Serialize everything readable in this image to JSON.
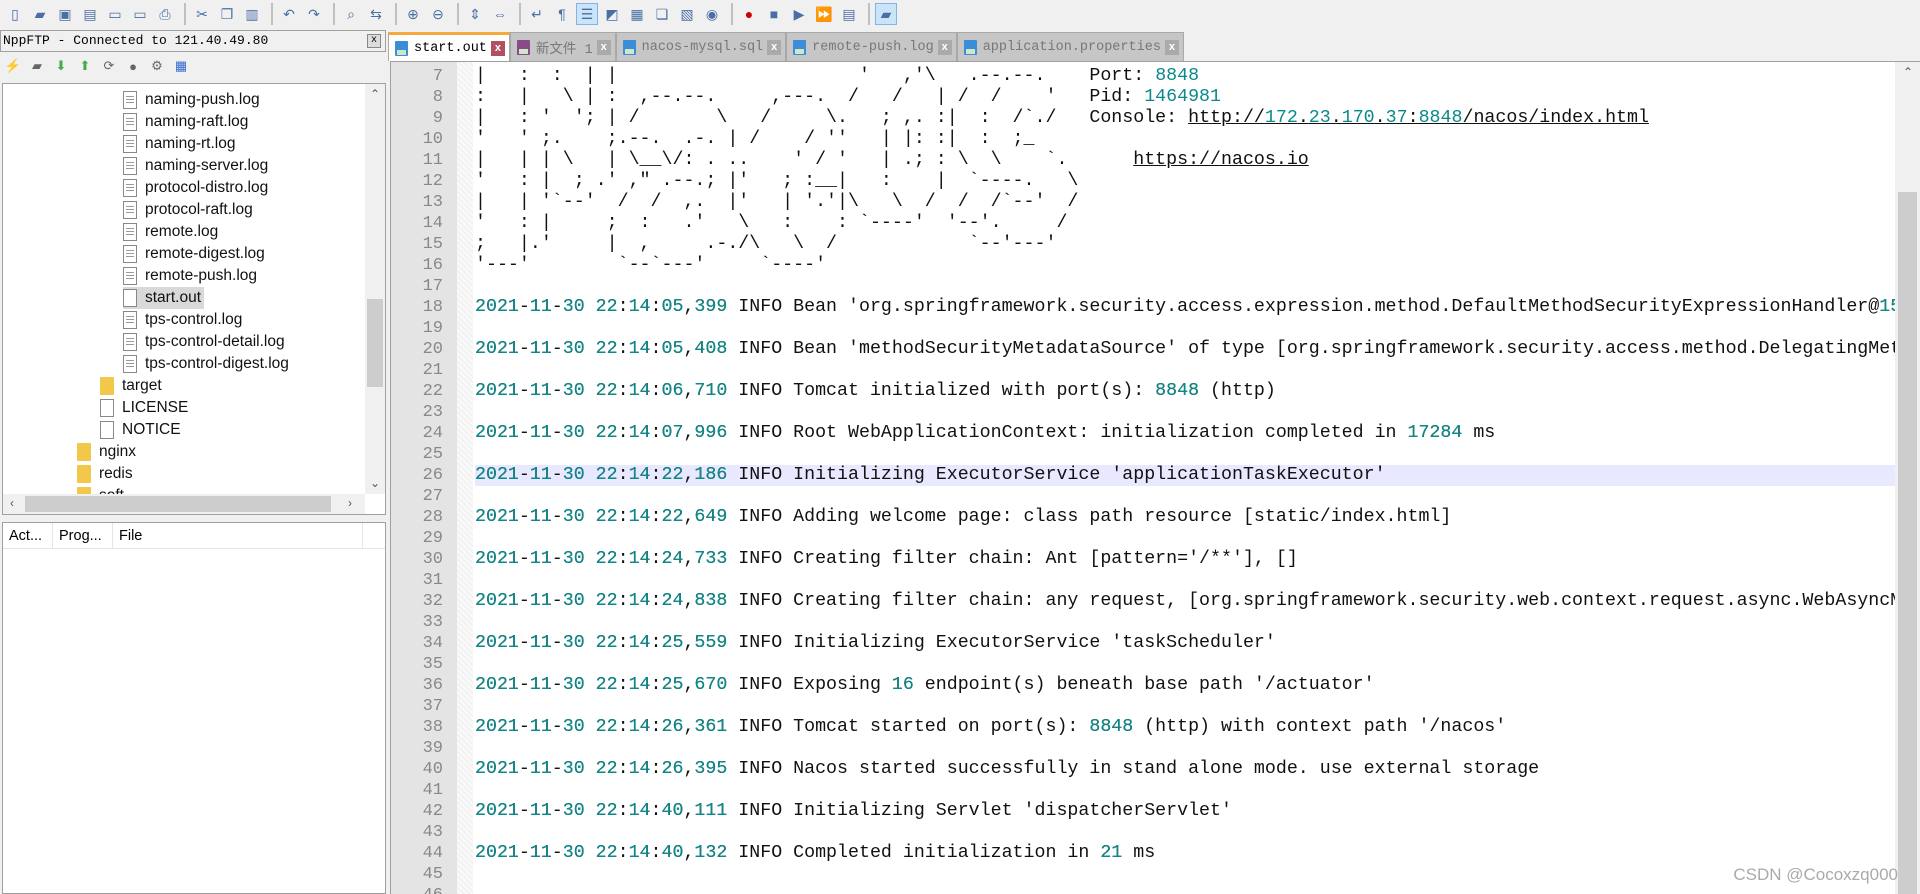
{
  "toolbar": {
    "icons": [
      "new-file-icon",
      "open-file-icon",
      "save-icon",
      "save-all-icon",
      "close-icon",
      "close-all-icon",
      "print-icon",
      "sep",
      "cut-icon",
      "copy-icon",
      "paste-icon",
      "sep",
      "undo-icon",
      "redo-icon",
      "sep",
      "find-icon",
      "replace-icon",
      "sep",
      "zoom-in-icon",
      "zoom-out-icon",
      "sep",
      "sync-vertical-icon",
      "sync-horizontal-icon",
      "sep",
      "word-wrap-icon",
      "show-all-chars-icon",
      "indent-guide-icon",
      "user-defined-language-icon",
      "document-map-icon",
      "function-list-icon",
      "folder-workspace-icon",
      "monitoring-icon",
      "sep",
      "record-macro-icon",
      "stop-macro-icon",
      "play-macro-icon",
      "run-macro-multiple-icon",
      "save-macro-icon",
      "sep",
      "nppftp-icon"
    ],
    "active": [
      "indent-guide-icon",
      "nppftp-icon"
    ]
  },
  "ftp": {
    "title": "NppFTP - Connected to 121.40.49.80",
    "close": "x",
    "tools": [
      "connect-icon",
      "open-directory-icon",
      "download-icon",
      "upload-icon",
      "refresh-icon",
      "abort-icon",
      "settings-icon",
      "message-window-icon"
    ],
    "tree": [
      {
        "label": "naming-push.log",
        "type": "log",
        "depth": 3
      },
      {
        "label": "naming-raft.log",
        "type": "log",
        "depth": 3
      },
      {
        "label": "naming-rt.log",
        "type": "log",
        "depth": 3
      },
      {
        "label": "naming-server.log",
        "type": "log",
        "depth": 3
      },
      {
        "label": "protocol-distro.log",
        "type": "log",
        "depth": 3
      },
      {
        "label": "protocol-raft.log",
        "type": "log",
        "depth": 3
      },
      {
        "label": "remote.log",
        "type": "log",
        "depth": 3
      },
      {
        "label": "remote-digest.log",
        "type": "log",
        "depth": 3
      },
      {
        "label": "remote-push.log",
        "type": "log",
        "depth": 3
      },
      {
        "label": "start.out",
        "type": "file",
        "depth": 3,
        "selected": true
      },
      {
        "label": "tps-control.log",
        "type": "log",
        "depth": 3
      },
      {
        "label": "tps-control-detail.log",
        "type": "log",
        "depth": 3
      },
      {
        "label": "tps-control-digest.log",
        "type": "log",
        "depth": 3
      },
      {
        "label": "target",
        "type": "folder",
        "depth": 2
      },
      {
        "label": "LICENSE",
        "type": "file",
        "depth": 2
      },
      {
        "label": "NOTICE",
        "type": "file",
        "depth": 2
      },
      {
        "label": "nginx",
        "type": "folder",
        "depth": 1
      },
      {
        "label": "redis",
        "type": "folder",
        "depth": 1
      },
      {
        "label": "soft",
        "type": "folder",
        "depth": 1
      }
    ],
    "queue_columns": [
      "Act...",
      "Prog...",
      "File"
    ]
  },
  "tabs": [
    {
      "label": "start.out",
      "active": true,
      "color": "#3b8dd8"
    },
    {
      "label": "新文件 1",
      "color": "#8a4a8a"
    },
    {
      "label": "nacos-mysql.sql",
      "color": "#3b8dd8"
    },
    {
      "label": "remote-push.log",
      "color": "#3b8dd8"
    },
    {
      "label": "application.properties",
      "color": "#3b8dd8"
    }
  ],
  "editor": {
    "first_line": 7,
    "current_line": 26,
    "lines": [
      "|   :  :  | |                      '   ,'\\   .--.--.    Port: 8848",
      ":   |   \\ | :  ,--.--.     ,---.  /   /   | /  /    '   Pid: 1464981",
      "|   : '  '; | /       \\   /     \\.   ; ,. :|  :  /`./   Console: http://172.23.170.37:8848/nacos/index.html",
      "'   ' ;.    ;.--.  .-. | /    / ''   | |: :|  :  ;_",
      "|   | | \\   | \\__\\/: . ..    ' / '   | .; : \\  \\    `.      https://nacos.io",
      "'   : |  ; .' ,\" .--.; |'   ; :__|   :    |  `----.   \\",
      "|   | '`--'  /  /  ,.  |'   | '.'|\\   \\  /  /  /`--'  /",
      "'   : |     ;  :   .'   \\   :    : `----'  '--'.     /",
      ";   |.'     |  ,     .-./\\   \\  /            `--'---'",
      "'---'        `--`---'     `----'",
      "",
      "2021-11-30 22:14:05,399 INFO Bean 'org.springframework.security.access.expression.method.DefaultMethodSecurityExpressionHandler@15",
      "",
      "2021-11-30 22:14:05,408 INFO Bean 'methodSecurityMetadataSource' of type [org.springframework.security.access.method.DelegatingMet",
      "",
      "2021-11-30 22:14:06,710 INFO Tomcat initialized with port(s): 8848 (http)",
      "",
      "2021-11-30 22:14:07,996 INFO Root WebApplicationContext: initialization completed in 17284 ms",
      "",
      "2021-11-30 22:14:22,186 INFO Initializing ExecutorService 'applicationTaskExecutor'",
      "",
      "2021-11-30 22:14:22,649 INFO Adding welcome page: class path resource [static/index.html]",
      "",
      "2021-11-30 22:14:24,733 INFO Creating filter chain: Ant [pattern='/**'], []",
      "",
      "2021-11-30 22:14:24,838 INFO Creating filter chain: any request, [org.springframework.security.web.context.request.async.WebAsyncM",
      "",
      "2021-11-30 22:14:25,559 INFO Initializing ExecutorService 'taskScheduler'",
      "",
      "2021-11-30 22:14:25,670 INFO Exposing 16 endpoint(s) beneath base path '/actuator'",
      "",
      "2021-11-30 22:14:26,361 INFO Tomcat started on port(s): 8848 (http) with context path '/nacos'",
      "",
      "2021-11-30 22:14:26,395 INFO Nacos started successfully in stand alone mode. use external storage",
      "",
      "2021-11-30 22:14:40,111 INFO Initializing Servlet 'dispatcherServlet'",
      "",
      "2021-11-30 22:14:40,132 INFO Completed initialization in 21 ms",
      "",
      ""
    ],
    "number_color": "#0a8a8a"
  },
  "watermark": "CSDN @Cocoxzq000"
}
